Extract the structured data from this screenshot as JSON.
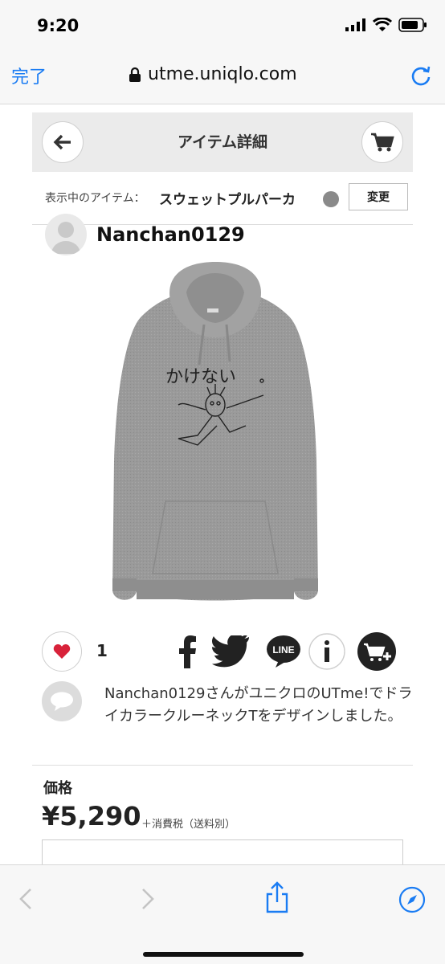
{
  "status_bar": {
    "time": "9:20"
  },
  "browser": {
    "done_label": "完了",
    "url": "utme.uniqlo.com"
  },
  "item_header": {
    "title": "アイテム詳細"
  },
  "item_row": {
    "label": "表示中のアイテム：",
    "name": "スウェットプルパーカ",
    "change_label": "変更",
    "color_hex": "#8a8a8a"
  },
  "user": {
    "name": "Nanchan0129"
  },
  "product_image": {
    "scribble_text": "かけない"
  },
  "actions": {
    "like_count": "1",
    "share_icons": [
      "facebook-icon",
      "twitter-icon",
      "line-icon",
      "info-icon",
      "add-to-cart-icon"
    ],
    "line_label": "LINE"
  },
  "description": {
    "text": "Nanchan0129さんがユニクロのUTme!でドライカラークルーネックTをデザインしました。"
  },
  "price": {
    "label": "価格",
    "value": "¥5,290",
    "tax_note": "＋消費税（送料別）"
  },
  "colors": {
    "accent": "#1a7cf3",
    "heart": "#d8223a",
    "header_bg": "#ebebeb"
  }
}
